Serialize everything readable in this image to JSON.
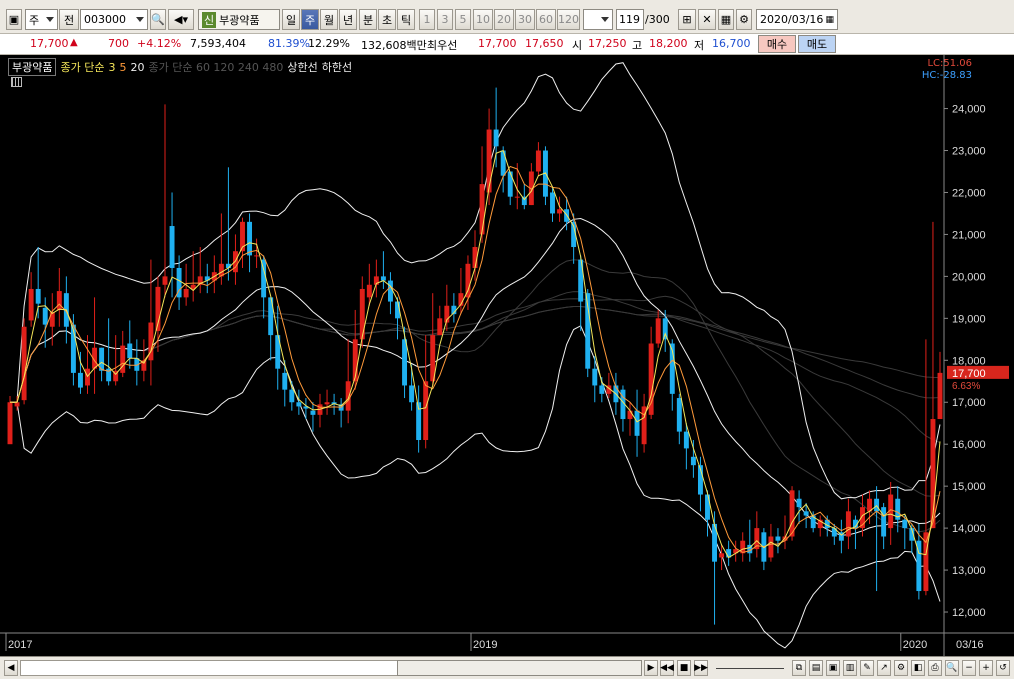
{
  "toolbar": {
    "market_type": "주",
    "prev_label": "전",
    "stock_code": "003000",
    "credit_badge": "신",
    "stock_name": "부광약품",
    "periods": [
      "일",
      "주",
      "월",
      "년",
      "분",
      "초",
      "틱"
    ],
    "active_period": "주",
    "minute_values": [
      "1",
      "3",
      "5",
      "10",
      "20",
      "30",
      "60",
      "120"
    ],
    "page_position": "119",
    "page_total": "/300",
    "date": "2020/03/16"
  },
  "quote": {
    "price": "17,700",
    "change": "700",
    "change_pct": "+4.12%",
    "volume": "7,593,404",
    "vol_ratio": "81.39%",
    "turnover": "12.29%",
    "amount": "132,608백만",
    "best_label": "최우선",
    "best_ask": "17,700",
    "best_bid": "17,650",
    "open_label": "시",
    "open": "17,250",
    "high_label": "고",
    "high": "18,200",
    "low_label": "저",
    "low": "16,700",
    "buy_label": "매수",
    "sell_label": "매도"
  },
  "legend": {
    "name": "부광약품",
    "ma_label": "종가 단순",
    "ma_short": [
      "3",
      "5",
      "20"
    ],
    "ma_long_label": "종가 단순 60 120 240 480",
    "upper_limit": "상한선",
    "lower_limit": "하한선",
    "lc": "LC:51.06",
    "hc": "HC:-28.83"
  },
  "axis": {
    "y_ticks": [
      "24,000",
      "23,000",
      "22,000",
      "21,000",
      "20,000",
      "19,000",
      "18,000",
      "17,000",
      "16,000",
      "15,000",
      "14,000",
      "13,000",
      "12,000"
    ],
    "x_ticks": [
      "2017",
      "2019",
      "2020"
    ],
    "last_date": "03/16",
    "current_price": "17,700",
    "current_pct": "6.63%"
  },
  "chart_data": {
    "type": "candlestick",
    "ylim": [
      11500,
      24800
    ],
    "colors": {
      "up": "#e0201a",
      "down": "#1fb0f0",
      "ma3": "#f5e65a",
      "ma5": "#ff9a3a",
      "band": "#f0f0f0",
      "long_ma": "#3a3a3a"
    },
    "candles": [
      [
        16000,
        17000,
        16500,
        17150
      ],
      [
        16900,
        17000,
        16800,
        17150
      ],
      [
        17050,
        18800,
        16950,
        19000
      ],
      [
        18950,
        19700,
        18800,
        20100
      ],
      [
        19700,
        19350,
        19000,
        20700
      ],
      [
        19250,
        18850,
        18300,
        19500
      ],
      [
        18800,
        19150,
        18350,
        19600
      ],
      [
        19200,
        19650,
        18800,
        20200
      ],
      [
        19600,
        18800,
        18400,
        20000
      ],
      [
        18850,
        17700,
        17400,
        19100
      ],
      [
        17700,
        17350,
        17200,
        18200
      ],
      [
        17400,
        17800,
        17200,
        18600
      ],
      [
        17800,
        18300,
        17200,
        19500
      ],
      [
        18300,
        17750,
        17500,
        18300
      ],
      [
        17800,
        17500,
        17400,
        19000
      ],
      [
        17500,
        17750,
        17400,
        18600
      ],
      [
        17700,
        18350,
        17600,
        18700
      ],
      [
        18400,
        18050,
        17800,
        18950
      ],
      [
        18050,
        17750,
        17400,
        18500
      ],
      [
        17750,
        18000,
        17500,
        18500
      ],
      [
        18000,
        18900,
        17400,
        20400
      ],
      [
        18700,
        19750,
        18200,
        20000
      ],
      [
        19800,
        20000,
        19500,
        24100
      ],
      [
        21200,
        20200,
        19500,
        22000
      ],
      [
        20200,
        19500,
        19200,
        20500
      ],
      [
        19500,
        19700,
        19300,
        20300
      ],
      [
        19700,
        19800,
        19400,
        20600
      ],
      [
        19800,
        20000,
        19600,
        20700
      ],
      [
        20000,
        19900,
        19600,
        20300
      ],
      [
        19900,
        20100,
        19600,
        20500
      ],
      [
        20000,
        20300,
        19800,
        21500
      ],
      [
        20300,
        20200,
        19900,
        22600
      ],
      [
        20100,
        20600,
        19800,
        21000
      ],
      [
        20600,
        21300,
        20200,
        21400
      ],
      [
        21300,
        20500,
        20100,
        21500
      ],
      [
        20500,
        20500,
        20200,
        20900
      ],
      [
        20400,
        19500,
        19000,
        20500
      ],
      [
        19500,
        18600,
        18000,
        19500
      ],
      [
        18600,
        17800,
        17300,
        19300
      ],
      [
        17700,
        17300,
        16900,
        18000
      ],
      [
        17300,
        17000,
        16800,
        17500
      ],
      [
        17000,
        16900,
        16700,
        17300
      ],
      [
        16900,
        16850,
        16600,
        17100
      ],
      [
        16800,
        16700,
        16300,
        17000
      ],
      [
        16700,
        16950,
        16400,
        17200
      ],
      [
        16950,
        17000,
        16700,
        17300
      ],
      [
        17000,
        16950,
        16700,
        17200
      ],
      [
        16950,
        16800,
        16400,
        17100
      ],
      [
        16800,
        17500,
        16500,
        18500
      ],
      [
        17500,
        18500,
        17300,
        19200
      ],
      [
        18500,
        19700,
        18300,
        20000
      ],
      [
        19500,
        19800,
        19300,
        20300
      ],
      [
        19800,
        20000,
        19500,
        20400
      ],
      [
        20000,
        19900,
        19700,
        20600
      ],
      [
        19900,
        19400,
        19100,
        20100
      ],
      [
        19400,
        19000,
        18500,
        19500
      ],
      [
        18500,
        17400,
        17100,
        18800
      ],
      [
        17400,
        17000,
        16800,
        17900
      ],
      [
        17000,
        16100,
        15800,
        17400
      ],
      [
        16100,
        17500,
        15900,
        18600
      ],
      [
        17500,
        18600,
        17400,
        19600
      ],
      [
        18600,
        19000,
        18600,
        19300
      ],
      [
        18900,
        19300,
        18700,
        19800
      ],
      [
        19300,
        19100,
        18900,
        19600
      ],
      [
        19300,
        19600,
        19100,
        20200
      ],
      [
        19500,
        20300,
        19200,
        20500
      ],
      [
        20200,
        20700,
        19900,
        21100
      ],
      [
        21000,
        22200,
        20800,
        23100
      ],
      [
        22000,
        23500,
        21700,
        24000
      ],
      [
        23500,
        23100,
        22600,
        24500
      ],
      [
        23000,
        22400,
        22000,
        23100
      ],
      [
        22500,
        21900,
        21700,
        22500
      ],
      [
        21900,
        21900,
        21600,
        22700
      ],
      [
        21900,
        21700,
        21600,
        22200
      ],
      [
        21700,
        22500,
        21700,
        22700
      ],
      [
        22500,
        23000,
        22400,
        23200
      ],
      [
        23000,
        21900,
        21700,
        23100
      ],
      [
        22000,
        21500,
        21300,
        22100
      ],
      [
        21500,
        21600,
        21300,
        21900
      ],
      [
        21600,
        21300,
        21100,
        21900
      ],
      [
        21300,
        20700,
        20300,
        21500
      ],
      [
        20400,
        19400,
        18700,
        20500
      ],
      [
        19600,
        17800,
        17600,
        19700
      ],
      [
        17800,
        17400,
        17000,
        18100
      ],
      [
        17400,
        17200,
        17000,
        17600
      ],
      [
        17200,
        17400,
        17100,
        17700
      ],
      [
        17400,
        17000,
        16700,
        17700
      ],
      [
        17300,
        16600,
        16300,
        17400
      ],
      [
        16600,
        16800,
        16200,
        17000
      ],
      [
        16800,
        16200,
        15700,
        17300
      ],
      [
        16000,
        16900,
        15800,
        17200
      ],
      [
        16700,
        18400,
        16600,
        18800
      ],
      [
        18400,
        19000,
        18300,
        19200
      ],
      [
        19000,
        18500,
        18200,
        19200
      ],
      [
        18400,
        17200,
        16800,
        18500
      ],
      [
        17100,
        16300,
        16000,
        17200
      ],
      [
        16300,
        15900,
        15400,
        16500
      ],
      [
        15700,
        15500,
        15200,
        16100
      ],
      [
        15500,
        14800,
        14400,
        15700
      ],
      [
        14800,
        14200,
        13800,
        14900
      ],
      [
        14100,
        13200,
        11700,
        14400
      ],
      [
        13300,
        13400,
        13000,
        13600
      ],
      [
        13500,
        13300,
        13100,
        13700
      ],
      [
        13400,
        13500,
        13200,
        13700
      ],
      [
        13400,
        13700,
        13200,
        13900
      ],
      [
        13600,
        13400,
        13200,
        14200
      ],
      [
        13500,
        14000,
        13300,
        14400
      ],
      [
        13900,
        13200,
        13000,
        14000
      ],
      [
        13300,
        13800,
        13200,
        14100
      ],
      [
        13800,
        13700,
        13400,
        14000
      ],
      [
        13700,
        13800,
        13500,
        14300
      ],
      [
        13800,
        14900,
        13700,
        15000
      ],
      [
        14700,
        14500,
        14100,
        14900
      ],
      [
        14400,
        14300,
        14000,
        14600
      ],
      [
        14300,
        14000,
        13900,
        14400
      ],
      [
        14000,
        14200,
        13800,
        14300
      ],
      [
        14200,
        14000,
        13800,
        14300
      ],
      [
        14000,
        13800,
        13600,
        14100
      ],
      [
        13900,
        13700,
        13400,
        14200
      ],
      [
        13800,
        14400,
        13500,
        14700
      ],
      [
        14200,
        14000,
        13500,
        14300
      ],
      [
        14000,
        14500,
        13800,
        14800
      ],
      [
        14400,
        14700,
        14100,
        14900
      ],
      [
        14700,
        14400,
        12500,
        15000
      ],
      [
        14500,
        13800,
        13500,
        14600
      ],
      [
        14000,
        14800,
        13600,
        15100
      ],
      [
        14700,
        14200,
        13900,
        15000
      ],
      [
        14200,
        14000,
        13500,
        14300
      ],
      [
        14000,
        13700,
        13400,
        14100
      ],
      [
        13700,
        12500,
        12300,
        14100
      ],
      [
        12500,
        13900,
        12400,
        18500
      ],
      [
        14000,
        16600,
        14000,
        21300
      ],
      [
        16600,
        17700,
        16700,
        18200
      ]
    ]
  }
}
